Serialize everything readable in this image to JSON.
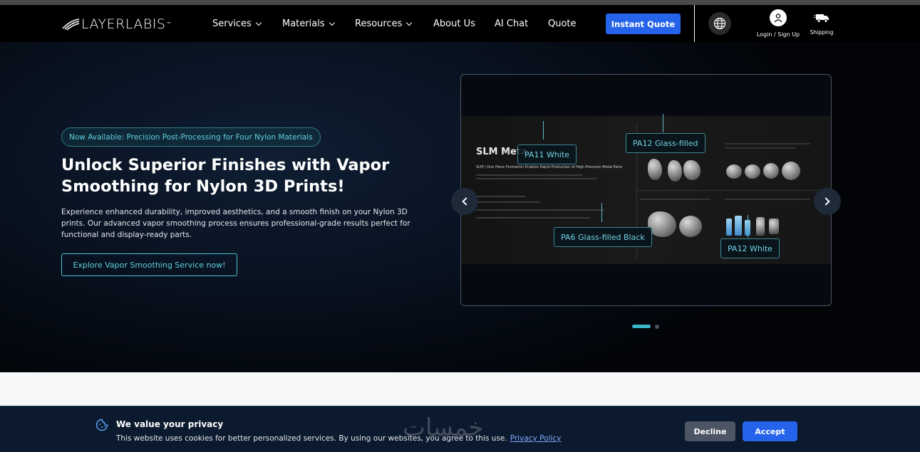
{
  "brand": {
    "logo_text": "LAYERLABIS",
    "trademark": "™"
  },
  "nav": {
    "items": [
      {
        "label": "Services",
        "dropdown": true
      },
      {
        "label": "Materials",
        "dropdown": true
      },
      {
        "label": "Resources",
        "dropdown": true
      },
      {
        "label": "About Us",
        "dropdown": false
      },
      {
        "label": "AI Chat",
        "dropdown": false
      },
      {
        "label": "Quote",
        "dropdown": false
      }
    ],
    "cta_label": "Instant Quote",
    "login_label": "Login / Sign Up",
    "shipping_label": "Shipping",
    "icons": {
      "language": "globe-icon",
      "account": "user-icon",
      "shipping": "truck-icon"
    }
  },
  "hero": {
    "badge": "Now Available: Precision Post-Processing for Four Nylon Materials",
    "title": "Unlock Superior Finishes with Vapor Smoothing for Nylon 3D Prints!",
    "description": "Experience enhanced durability, improved aesthetics, and a smooth finish on your Nylon 3D prints. Our advanced vapor smoothing process ensures professional-grade results perfect for functional and display-ready parts.",
    "cta_label": "Explore Vapor Smoothing Service now!"
  },
  "carousel": {
    "slide_title": "SLM Meta",
    "slide_subtitle": "SLM | One Piece Formation Enables Rapid Production of High-Precision Metal Parts",
    "callouts": [
      "PA11 White",
      "PA12 Glass-filled",
      "PA6 Glass-filled Black",
      "PA12 White"
    ],
    "slide_count": 2,
    "active_index": 0,
    "prev_icon": "chevron-left-icon",
    "next_icon": "chevron-right-icon"
  },
  "cookie": {
    "title": "We value your privacy",
    "text": "This website uses cookies for better personalized services. By using our websites, you agree to this use.",
    "link_label": "Privacy Policy",
    "decline_label": "Decline",
    "accept_label": "Accept"
  },
  "watermark": "خمسات",
  "colors": {
    "accent": "#2563eb",
    "teal": "#45c6d8",
    "background": "#000000",
    "cookie_bg": "#0b1a2e"
  }
}
